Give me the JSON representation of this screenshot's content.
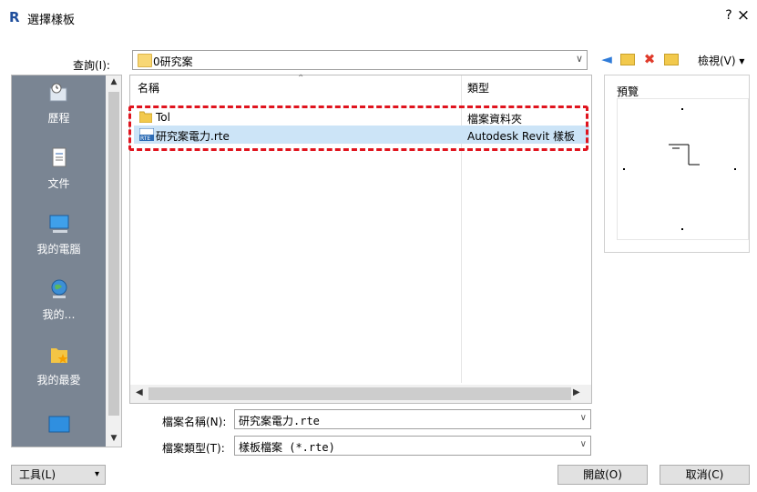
{
  "window": {
    "logo": "R",
    "title": "選擇樣板",
    "help_label": "?",
    "close_label": "×"
  },
  "lookin": {
    "label": "查詢(I):",
    "value": "0研究案",
    "dropdown_icon": "chevron-down-icon"
  },
  "toolbar": {
    "back_icon": "back-arrow-icon",
    "up_icon": "up-folder-icon",
    "delete_icon": "delete-icon",
    "newfolder_icon": "new-folder-icon",
    "view_label": "檢視(V)",
    "view_arrow": "▾"
  },
  "places": {
    "items": [
      {
        "label": "歷程",
        "icon": "history-icon"
      },
      {
        "label": "文件",
        "icon": "documents-icon"
      },
      {
        "label": "我的電腦",
        "icon": "computer-icon"
      },
      {
        "label": "我的…",
        "icon": "network-icon"
      },
      {
        "label": "我的最愛",
        "icon": "favorites-icon"
      },
      {
        "label": "",
        "icon": "desktop-icon"
      }
    ]
  },
  "filelist": {
    "columns": {
      "name": "名稱",
      "type": "類型"
    },
    "rows": [
      {
        "name": "Tol",
        "type": "檔案資料夾",
        "icon": "folder-icon"
      },
      {
        "name": "研究案電力.rte",
        "type": "Autodesk Revit 樣板",
        "icon": "rte-file-icon",
        "selected": true
      }
    ]
  },
  "preview": {
    "label": "預覽"
  },
  "filename": {
    "label": "檔案名稱(N):",
    "value": "研究案電力.rte"
  },
  "filetype": {
    "label": "檔案類型(T):",
    "value": "樣板檔案  (*.rte)"
  },
  "buttons": {
    "tools": "工具(L)",
    "tools_arrow": "▾",
    "open": "開啟(O)",
    "cancel": "取消(C)"
  },
  "colors": {
    "highlight_border": "#e0141e",
    "selection": "#cce4f7",
    "places_bg": "#7a8593"
  }
}
